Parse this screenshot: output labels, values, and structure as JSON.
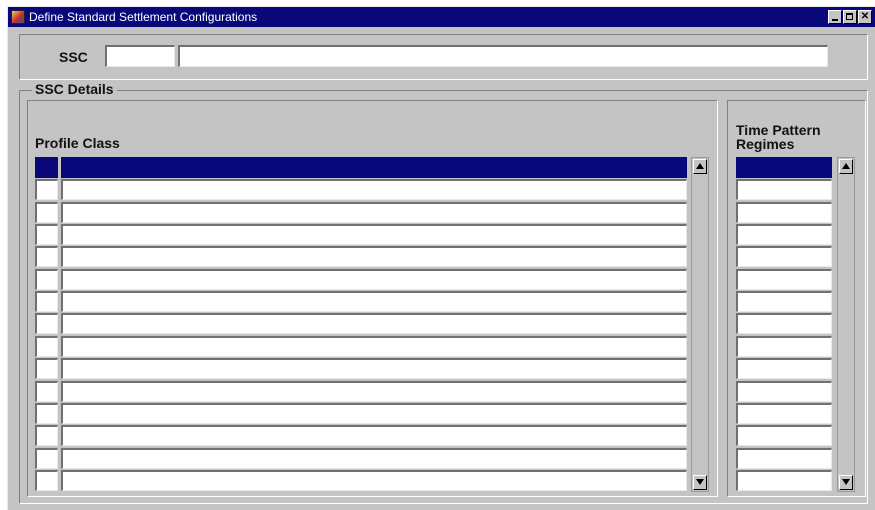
{
  "window": {
    "title": "Define Standard Settlement Configurations",
    "app_icon": "oracle-forms-icon",
    "controls": [
      "minimize-icon",
      "maximize-icon",
      "close-icon"
    ]
  },
  "header": {
    "ssc_label": "SSC",
    "ssc_code_value": "",
    "ssc_description_value": ""
  },
  "details": {
    "legend": "SSC Details",
    "profile_class": {
      "heading": "Profile Class",
      "row_count": 15,
      "selected_row": 1,
      "rows": [
        "",
        "",
        "",
        "",
        "",
        "",
        "",
        "",
        "",
        "",
        "",
        "",
        "",
        "",
        ""
      ]
    },
    "time_pattern_regimes": {
      "heading_line1": "Time Pattern",
      "heading_line2": "Regimes",
      "row_count": 15,
      "selected_row": 1,
      "rows": [
        "",
        "",
        "",
        "",
        "",
        "",
        "",
        "",
        "",
        "",
        "",
        "",
        "",
        "",
        ""
      ]
    }
  },
  "colors": {
    "title_bar": "#08087a",
    "selected_row": "#08087a",
    "form_background": "#c4c4c4"
  }
}
